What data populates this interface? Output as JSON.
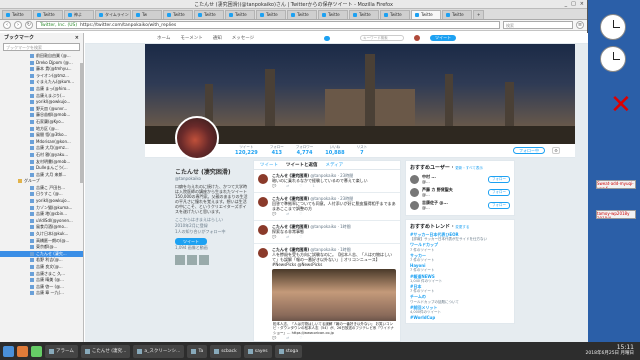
{
  "window": {
    "title": "こたんせ (凄究困滑)(@tanpokaiko)さん | Twitterからの保存ツイート - Mozilla Firefox",
    "controls": [
      "_",
      "□",
      "×"
    ]
  },
  "tabs": [
    {
      "label": "Twitte"
    },
    {
      "label": "Twitte"
    },
    {
      "label": "神よ"
    },
    {
      "label": "タイムライン"
    },
    {
      "label": "Tw"
    },
    {
      "label": "Twitte"
    },
    {
      "label": "Twitte"
    },
    {
      "label": "Twitte"
    },
    {
      "label": "Twitte"
    },
    {
      "label": "Twitte"
    },
    {
      "label": "Twitte"
    },
    {
      "label": "Twitte"
    },
    {
      "label": "Twitte"
    },
    {
      "label": "Twitte"
    },
    {
      "label": "Twitte"
    }
  ],
  "navbar": {
    "site_label": "Twitter, Inc. (US)",
    "url": "https://twitter.com/tanpokaiko/with_replies",
    "search_placeholder": "検索"
  },
  "sidebar": {
    "title": "ブックマーク",
    "search_placeholder": "ブックマークを検索",
    "items": [
      {
        "label": "前田敦自由業 (@...",
        "type": "item"
      },
      {
        "label": "Dreko Djpom (@...",
        "type": "item"
      },
      {
        "label": "藤本 貴(@tmhyu...",
        "type": "item"
      },
      {
        "label": "ライオン(@tmz...",
        "type": "item"
      },
      {
        "label": "ぐまえたん(@kum...",
        "type": "item"
      },
      {
        "label": "吉康 まっ(@hiro...",
        "type": "item"
      },
      {
        "label": "吉康えまぶり(...",
        "type": "item"
      },
      {
        "label": "yorikl(@owkujo...",
        "type": "item"
      },
      {
        "label": "野天皿 (@unvr...",
        "type": "item"
      },
      {
        "label": "藤谷苗郁(@mob...",
        "type": "item"
      },
      {
        "label": "石家蘭(@Kyo...",
        "type": "item"
      },
      {
        "label": "地方区 (@...",
        "type": "item"
      },
      {
        "label": "風間 悟(@3tko...",
        "type": "item"
      },
      {
        "label": "Mdorisan(@kon...",
        "type": "item"
      },
      {
        "label": "吉康 大月(@mz...",
        "type": "item"
      },
      {
        "label": "石村 雅(@yaku...",
        "type": "item"
      },
      {
        "label": "友村明書(@mob...",
        "type": "item"
      },
      {
        "label": "Dulleまんごう(...",
        "type": "item"
      },
      {
        "label": "吉康 大月 来郎...",
        "type": "item"
      },
      {
        "label": "グループ",
        "type": "folder"
      },
      {
        "label": "吉康こ 戸田台...",
        "type": "item"
      },
      {
        "label": "日りすこ (@...",
        "type": "item"
      },
      {
        "label": "yorikl(@owkujo...",
        "type": "item"
      },
      {
        "label": "カゾン猫(@kuma...",
        "type": "item"
      },
      {
        "label": "吉康 地(@cbin...",
        "type": "item"
      },
      {
        "label": "uVdlSdl(@yonen...",
        "type": "item"
      },
      {
        "label": "風食月酒(@mo...",
        "type": "item"
      },
      {
        "label": "久け日本(@kuk...",
        "type": "item"
      },
      {
        "label": "高橋匿一朗の(@...",
        "type": "item"
      },
      {
        "label": "東京都(@...",
        "type": "item"
      },
      {
        "label": "こたんせ (凄究...",
        "type": "item",
        "selected": true
      },
      {
        "label": "若野 利吉(@...",
        "type": "item"
      },
      {
        "label": "吉康 良文(@...",
        "type": "item"
      },
      {
        "label": "吉康さまこ 久...",
        "type": "item"
      },
      {
        "label": "吉康 晴美 (@...",
        "type": "item"
      },
      {
        "label": "吉康 啓一 (@...",
        "type": "item"
      },
      {
        "label": "吉康 章 一九(...",
        "type": "item"
      }
    ]
  },
  "twitter_nav": {
    "home": "ホーム",
    "moments": "モーメント",
    "notifications": "通知",
    "messages": "メッセージ",
    "search_placeholder": "キーワード検索",
    "tweet_button": "ツイート"
  },
  "profile": {
    "stats": [
      {
        "label": "ツイート",
        "value": "120,229"
      },
      {
        "label": "フォロー",
        "value": "413"
      },
      {
        "label": "フォロワー",
        "value": "4,774"
      },
      {
        "label": "いいね",
        "value": "10,888"
      },
      {
        "label": "リスト",
        "value": "7"
      }
    ],
    "follow_button": "フォロー中",
    "name": "こたんせ (凄究困滑)",
    "handle": "@tanpokaiko",
    "bio": "口癖を与えれのに焼けた、かつて大学時は入院医師の講座から生まれたツイート150,000の専門家。父親のあまりの生活の平凡さに憧れを覚えます。想いは生活の中にこそ、というクリエイターズボイスを遂げたいと思います。",
    "location": "ここからはきまえはらしい",
    "joined": "2010年2月に登録",
    "followers_you_know": "1人の知り合いがフォロー中",
    "tweet_to": "ツイート",
    "media_label": "1,094 画像と動画"
  },
  "timeline": {
    "tabs": [
      "ツイート",
      "ツイートと返信",
      "メディア"
    ],
    "tweets": [
      {
        "name": "こたんせ (凄究困滑)",
        "handle": "@tanpokaiko · 23時間",
        "text": "暗いのに乗れるなかで経験しているので慕えて楽しい",
        "counts": "1"
      },
      {
        "name": "こたんせ (凄究困滑)",
        "handle": "@tanpokaiko · 23時間",
        "text": "回答で準拠率についても同意。人付添いが好に脱皮獲得相手までまあまあここまで調整の方",
        "counts": ""
      },
      {
        "name": "こたんせ (凄究困滑)",
        "handle": "@tanpokaiko · 1時間",
        "text": "探索なる非常事態",
        "counts": ""
      },
      {
        "name": "こたんせ (凄究困滑)",
        "handle": "@tanpokaiko · 1時間",
        "text": "人を惨殺を受も方向に試験なのに。【松本人志、「人は刃物はしいて」も誤解「報の一番好き以外ない」 | オリコンニュース】 #NewsPicks @NewsPicks",
        "caption": "松本人志、「人は刃物はしいてる誤解「報の一番好き以外ない」 お笑いコンビ・ダウンタウンの松本人志（54）が、26日放送のフジテレビ系『ワイドナショー』… https://www.oricon.co.jp",
        "counts": ""
      }
    ]
  },
  "suggestions": {
    "title": "おすすめユーザー",
    "refresh": "更新・すべて表示",
    "users": [
      {
        "name": "中村 ...",
        "handle": "@...",
        "button": "フォロー"
      },
      {
        "name": "芦藤 カ 野貸聖夫",
        "handle": "@...",
        "button": "フォロー"
      },
      {
        "name": "吉康佐子 @...",
        "handle": "@...",
        "button": "フォロー"
      }
    ]
  },
  "trends": {
    "title": "おすすめトレンド",
    "change": "変更する",
    "items": [
      {
        "tag": "#サッカー日本代表ひEOR",
        "desc": "【詳報】サッカー日本代表が左サイドを仕方ない"
      },
      {
        "tag": "ワールドカップ",
        "desc": "7 件のツイート"
      },
      {
        "tag": "サッカー",
        "desc": "7 件のツイート"
      },
      {
        "tag": "Hayoni",
        "desc": "7 件のツイート"
      },
      {
        "tag": "#報道NEWS",
        "desc": "1,040 件のツイート"
      },
      {
        "tag": "#日本",
        "desc": "7 件のツイート"
      },
      {
        "tag": "チームの",
        "desc": "ワールドカップの話題について"
      },
      {
        "tag": "#前回メリット",
        "desc": "4,000件のツイート"
      },
      {
        "tag": "#WorldCup",
        "desc": ""
      }
    ]
  },
  "desktop": {
    "tiles": [
      "Sweat-add-myuqi-ung-f",
      "tamoy-wp2018y 2018/4"
    ]
  },
  "taskbar": {
    "tasks": [
      "アラーム",
      "こたんせ (凄究...",
      "a_スクリーンシ...",
      "Ta",
      "scback",
      "sayes",
      "stoga"
    ],
    "clock_time": "15:11",
    "clock_date": "2018年6月25日 月曜日"
  },
  "colors": {
    "twitter_blue": "#1da1f2",
    "selected_bookmark": "#3a8ee6",
    "desktop_bg": "#2b5fa8"
  }
}
